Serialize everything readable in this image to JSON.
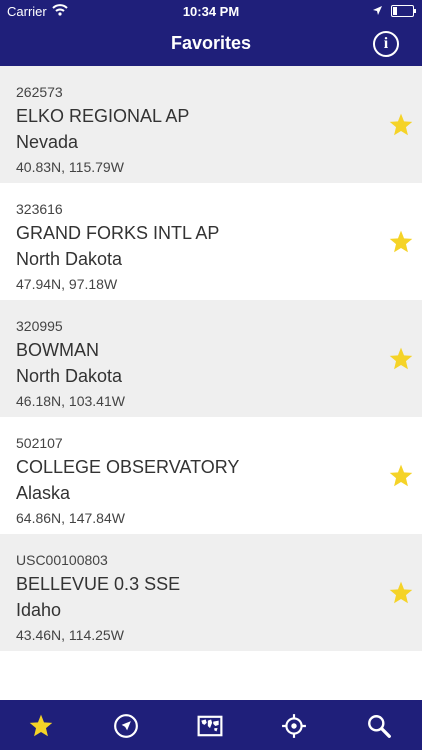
{
  "status_bar": {
    "carrier": "Carrier",
    "time": "10:34 PM"
  },
  "header": {
    "title": "Favorites",
    "info_label": "i"
  },
  "favorites": [
    {
      "code": "262573",
      "name": "ELKO REGIONAL AP",
      "state": "Nevada",
      "coords": "40.83N, 115.79W"
    },
    {
      "code": "323616",
      "name": "GRAND FORKS INTL AP",
      "state": "North Dakota",
      "coords": "47.94N, 97.18W"
    },
    {
      "code": "320995",
      "name": "BOWMAN",
      "state": "North Dakota",
      "coords": "46.18N, 103.41W"
    },
    {
      "code": "502107",
      "name": "COLLEGE OBSERVATORY",
      "state": "Alaska",
      "coords": "64.86N, 147.84W"
    },
    {
      "code": "USC00100803",
      "name": "BELLEVUE 0.3 SSE",
      "state": "Idaho",
      "coords": "43.46N, 114.25W"
    }
  ],
  "tab_bar": {
    "tabs": [
      "star-icon",
      "navigation-arrow-icon",
      "world-map-icon",
      "crosshair-icon",
      "search-icon"
    ],
    "active_tab": "star-icon"
  },
  "colors": {
    "nav_background": "#1f1f7a",
    "star": "#f5d327",
    "row_alt": "#efefef"
  }
}
